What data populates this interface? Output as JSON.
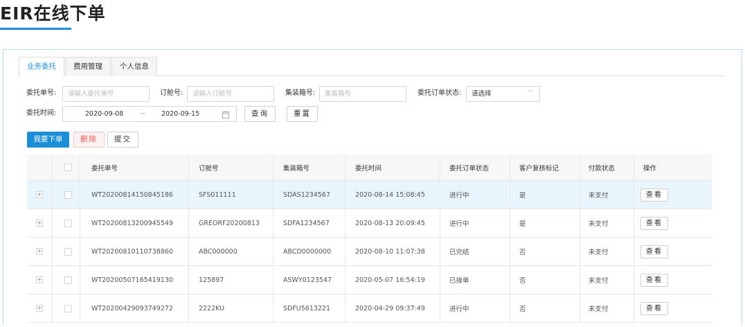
{
  "page": {
    "title": "EIR在线下单"
  },
  "tabs": [
    {
      "label": "业务委托",
      "active": true
    },
    {
      "label": "费用管理",
      "active": false
    },
    {
      "label": "个人信息",
      "active": false
    }
  ],
  "filters": {
    "entrust_no": {
      "label": "委托单号:",
      "placeholder": "请输入委托单号"
    },
    "booking_no": {
      "label": "订舱号:",
      "placeholder": "请输入订舱号"
    },
    "container_no": {
      "label": "集装箱号:",
      "placeholder": "集装箱号"
    },
    "order_status": {
      "label": "委托订单状态:",
      "value": "请选择"
    },
    "entrust_time": {
      "label": "委托时间:",
      "start": "2020-09-08",
      "separator": "~",
      "end": "2020-09-15"
    },
    "query_label": "查询",
    "reset_label": "重置"
  },
  "actions": {
    "order_label": "我要下单",
    "delete_label": "删除",
    "submit_label": "提交"
  },
  "table": {
    "columns": [
      "委托单号",
      "订舱号",
      "集装箱号",
      "委托时间",
      "委托订单状态",
      "客户复核标记",
      "付款状态",
      "操作"
    ],
    "view_label": "查看",
    "rows": [
      {
        "entrust_no": "WT20200814150845186",
        "booking_no": "SFS011111",
        "container_no": "SDAS1234567",
        "time": "2020-08-14 15:08:45",
        "status": "进行中",
        "review": "是",
        "payment": "未支付"
      },
      {
        "entrust_no": "WT20200813200945549",
        "booking_no": "GREORF20200813",
        "container_no": "SDFA1234567",
        "time": "2020-08-13 20:09:45",
        "status": "进行中",
        "review": "是",
        "payment": "未支付"
      },
      {
        "entrust_no": "WT20200810110738860",
        "booking_no": "ABC000000",
        "container_no": "ABCD0000000",
        "time": "2020-08-10 11:07:38",
        "status": "已完结",
        "review": "否",
        "payment": "未支付"
      },
      {
        "entrust_no": "WT20200507165419130",
        "booking_no": "125897",
        "container_no": "ASWY0123547",
        "time": "2020-05-07 16:54:19",
        "status": "已接单",
        "review": "否",
        "payment": "未支付"
      },
      {
        "entrust_no": "WT20200429093749272",
        "booking_no": "2222KU",
        "container_no": "SDFU5613221",
        "time": "2020-04-29 09:37:49",
        "status": "进行中",
        "review": "否",
        "payment": "未支付"
      }
    ]
  },
  "colors": {
    "accent": "#1a8fd8",
    "danger": "#ee5555",
    "highlight_row": "#e8f5fc"
  }
}
